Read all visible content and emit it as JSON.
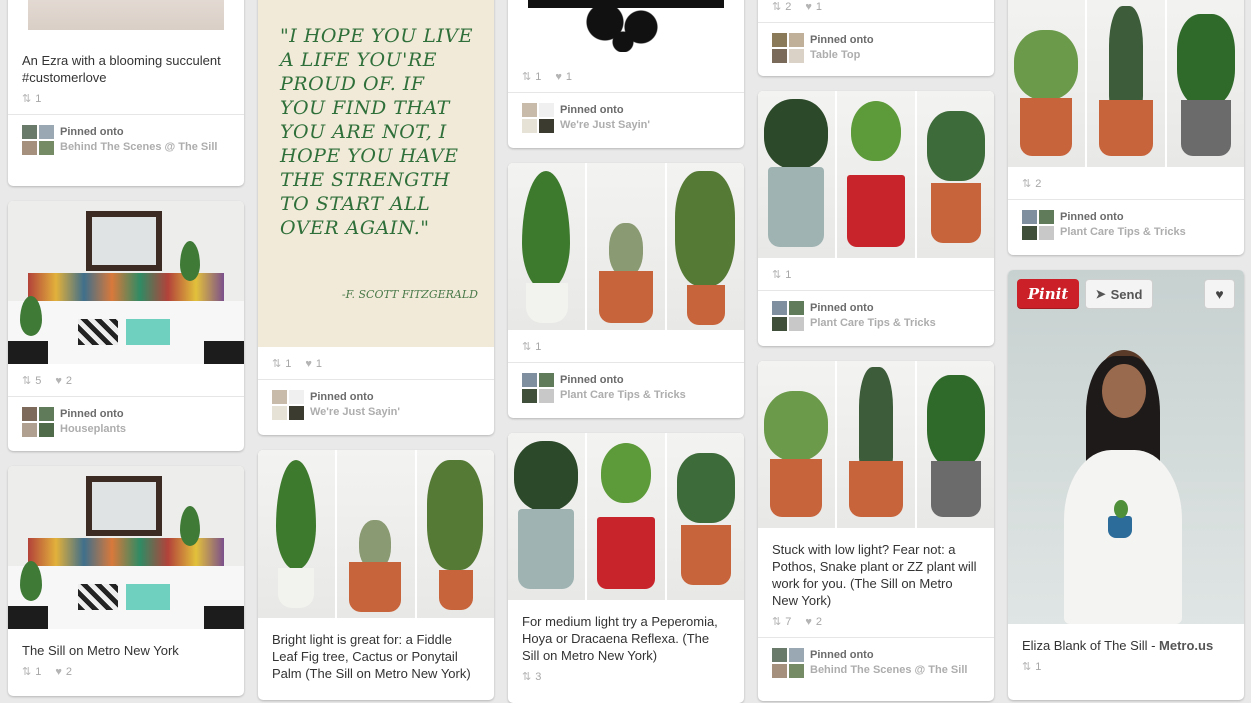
{
  "colors": {
    "background": "#e9e9e9",
    "pinit_red": "#cb2027",
    "quote_green": "#2f6f3a"
  },
  "pins": {
    "c1p1": {
      "desc": "An Ezra with a blooming succulent #customerlove",
      "repins": "1",
      "pinned": "Pinned onto",
      "board": "Behind The Scenes @ The Sill"
    },
    "c1p2": {
      "repins": "5",
      "likes": "2",
      "pinned": "Pinned onto",
      "board": "Houseplants"
    },
    "c1p3": {
      "desc": "The Sill on Metro New York",
      "repins": "1",
      "likes": "2"
    },
    "c2p1": {
      "quote": "\"I hope you live a life you're proud of. If you find that you are not, I hope you have the strength to start all over again.\"",
      "attribution": "-F. Scott Fitzgerald",
      "repins": "1",
      "likes": "1",
      "pinned": "Pinned onto",
      "board": "We're Just Sayin'"
    },
    "c2p2": {
      "desc": "Bright light is great for: a Fiddle Leaf Fig tree, Cactus or Ponytail Palm (The Sill on Metro New York)"
    },
    "c3p1": {
      "repins": "1",
      "likes": "1",
      "pinned": "Pinned onto",
      "board": "We're Just Sayin'"
    },
    "c3p2": {
      "repins": "1",
      "pinned": "Pinned onto",
      "board": "Plant Care Tips & Tricks"
    },
    "c3p3": {
      "desc": "For medium light try a Peperomia, Hoya or Dracaena Reflexa. (The Sill on Metro New York)",
      "repins": "3"
    },
    "c4p1": {
      "repins": "2",
      "likes": "1",
      "pinned": "Pinned onto",
      "board": "Table Top"
    },
    "c4p2": {
      "repins": "1",
      "pinned": "Pinned onto",
      "board": "Plant Care Tips & Tricks"
    },
    "c4p3": {
      "desc": "Stuck with low light? Fear not: a Pothos, Snake plant or ZZ plant will work for you. (The Sill on Metro New York)",
      "repins": "7",
      "likes": "2",
      "pinned": "Pinned onto",
      "board": "Behind The Scenes @ The Sill"
    },
    "c5p1": {
      "repins": "2",
      "pinned": "Pinned onto",
      "board": "Plant Care Tips & Tricks"
    },
    "c5p2": {
      "desc_prefix": "Eliza Blank of The Sill - ",
      "desc_source": "Metro.us",
      "repins": "1",
      "pinit_label": "Pinit",
      "send_label": "Send"
    }
  }
}
